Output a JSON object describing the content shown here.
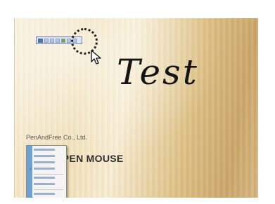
{
  "handwriting": {
    "text": "Test"
  },
  "slide": {
    "company": "PenAndFree Co., Ltd.",
    "product": "L PEN MOUSE"
  },
  "toolbar": {
    "buttons": [
      "pen",
      "highlighter",
      "eraser",
      "color",
      "undo",
      "close"
    ]
  },
  "context_menu": {
    "items": [
      {
        "checked": false
      },
      {
        "checked": false
      },
      {
        "checked": false
      },
      {
        "checked": true
      },
      {
        "checked": false
      },
      {
        "checked": false
      },
      {
        "checked": false
      },
      {
        "checked": false
      }
    ]
  },
  "icons": {
    "cursor": "arrow-cursor-icon",
    "highlight": "dotted-circle"
  }
}
